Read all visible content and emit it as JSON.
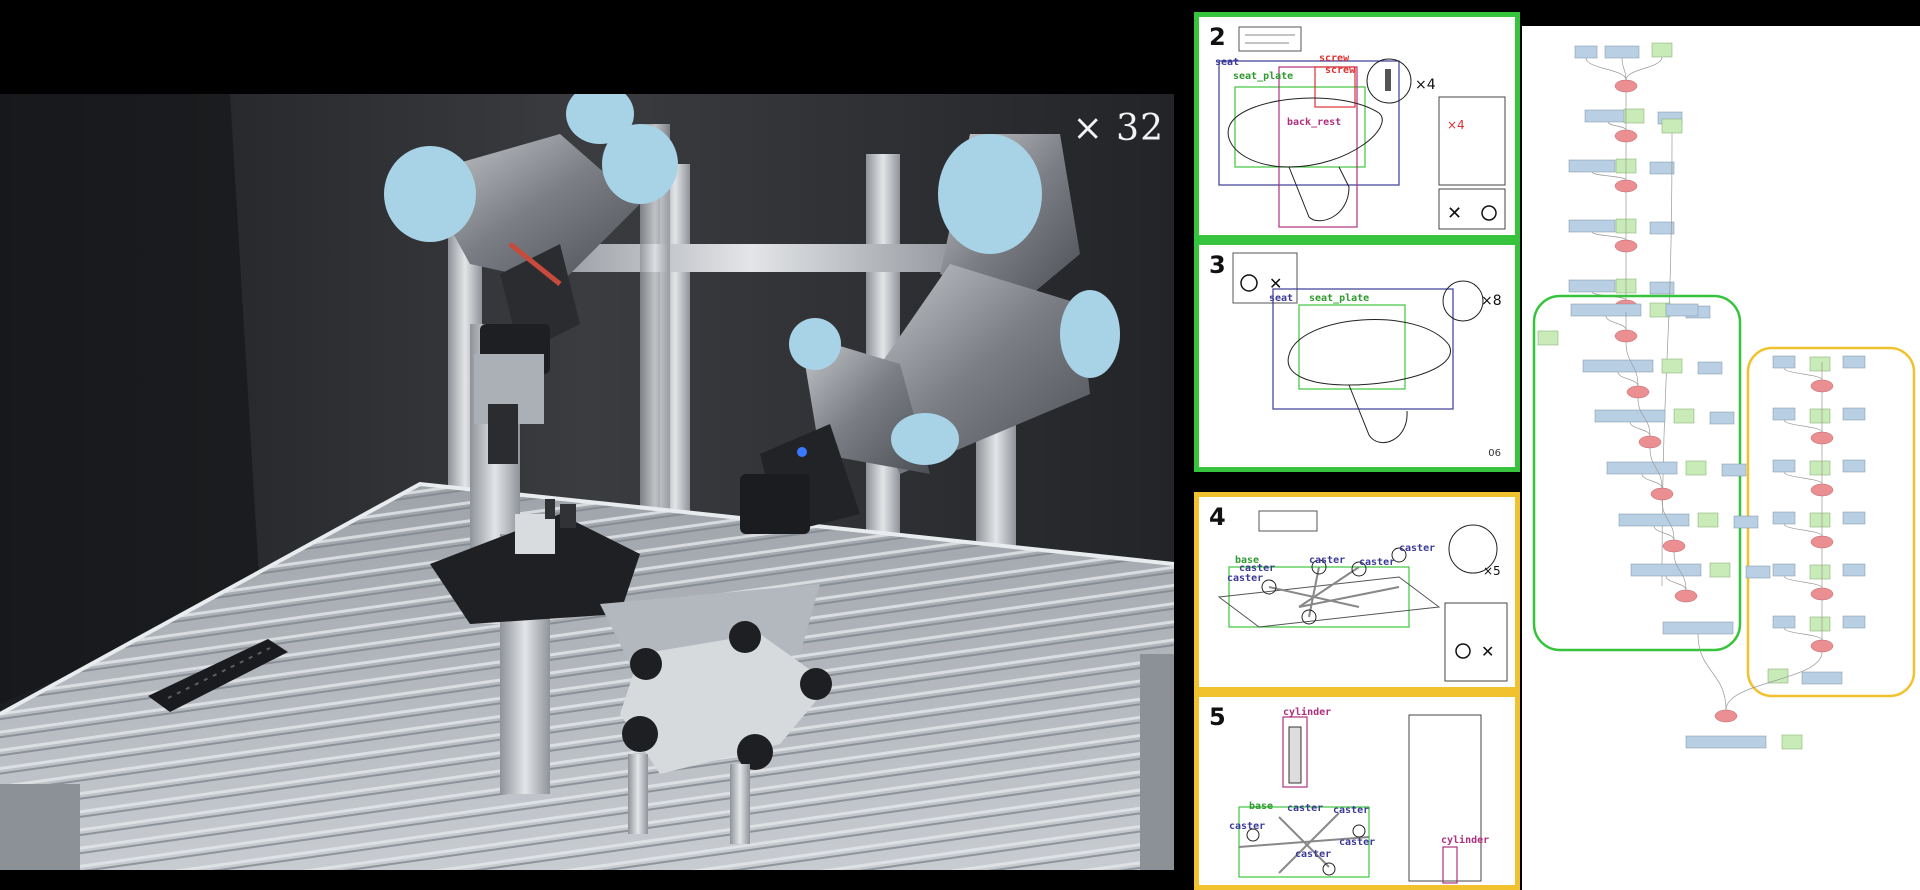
{
  "video": {
    "speed_label": "× 32"
  },
  "steps": [
    {
      "number": "2",
      "border": "#37c43c",
      "labels": [
        "seat",
        "seat_plate",
        "screw",
        "screw",
        "back_rest"
      ],
      "callout": "×4",
      "inset_callout": "×4"
    },
    {
      "number": "3",
      "border": "#37c43c",
      "labels": [
        "seat",
        "seat_plate"
      ],
      "callout": "×8",
      "page_number": "06"
    },
    {
      "number": "4",
      "border": "#f2c12e",
      "labels": [
        "caster",
        "caster",
        "caster",
        "caster",
        "base",
        "caster"
      ],
      "callout": "×5"
    },
    {
      "number": "5",
      "border": "#f2c12e",
      "labels": [
        "cylinder",
        "caster",
        "caster",
        "caster",
        "caster",
        "base",
        "caster",
        "cylinder"
      ]
    }
  ],
  "graph": {
    "colors": {
      "object_node": "#b9d0e4",
      "tool_node": "#c9ebb8",
      "action_node": "#ec8f93",
      "group_green": "#37c43c",
      "group_yellow": "#f2c12e"
    }
  }
}
